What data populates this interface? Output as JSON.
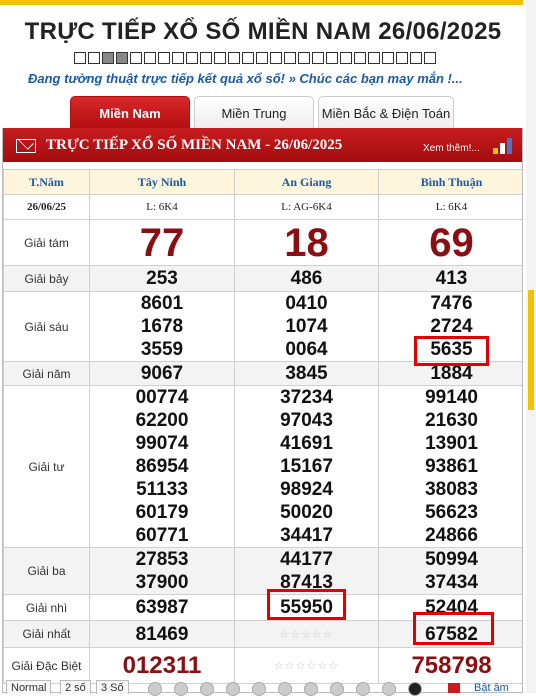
{
  "header": {
    "title": "TRỰC TIẾP XỔ SỐ MIỀN NAM 26/06/2025",
    "marquee": "Đang tường thuật trực tiếp kết quả xổ số! » Chúc các bạn may mắn !..."
  },
  "tabs": [
    {
      "label": "Miền Nam",
      "active": true
    },
    {
      "label": "Miền Trung",
      "active": false
    },
    {
      "label": "Miền Bắc & Điện Toán",
      "active": false
    }
  ],
  "panel": {
    "title": "TRỰC TIẾP XỔ SỐ MIỀN NAM - 26/06/2025",
    "more_link": "Xem thêm!..."
  },
  "table": {
    "col_header": "T.Năm",
    "provinces": [
      "Tây Ninh",
      "An Giang",
      "Bình Thuận"
    ],
    "date": "26/06/25",
    "codes": [
      "L: 6K4",
      "L: AG-6K4",
      "L: 6K4"
    ],
    "prizes": [
      {
        "label": "Giải tám",
        "values": [
          [
            "77"
          ],
          [
            "18"
          ],
          [
            "69"
          ]
        ]
      },
      {
        "label": "Giải bảy",
        "values": [
          [
            "253"
          ],
          [
            "486"
          ],
          [
            "413"
          ]
        ]
      },
      {
        "label": "Giải sáu",
        "values": [
          [
            "8601",
            "1678",
            "3559"
          ],
          [
            "0410",
            "1074",
            "0064"
          ],
          [
            "7476",
            "2724",
            "5635"
          ]
        ]
      },
      {
        "label": "Giải năm",
        "values": [
          [
            "9067"
          ],
          [
            "3845"
          ],
          [
            "1884"
          ]
        ]
      },
      {
        "label": "Giải tư",
        "values": [
          [
            "00774",
            "62200",
            "99074",
            "86954",
            "51133",
            "60179",
            "60771"
          ],
          [
            "37234",
            "97043",
            "41691",
            "15167",
            "98924",
            "50020",
            "34417"
          ],
          [
            "99140",
            "21630",
            "13901",
            "93861",
            "38083",
            "56623",
            "24866"
          ]
        ]
      },
      {
        "label": "Giải ba",
        "values": [
          [
            "27853",
            "37900"
          ],
          [
            "44177",
            "87413"
          ],
          [
            "50994",
            "37434"
          ]
        ]
      },
      {
        "label": "Giải nhì",
        "values": [
          [
            "63987"
          ],
          [
            "55950"
          ],
          [
            "52404"
          ]
        ]
      },
      {
        "label": "Giải nhất",
        "values": [
          [
            "81469"
          ],
          [
            "☆☆☆☆☆"
          ],
          [
            "67582"
          ]
        ]
      },
      {
        "label": "Giải Đặc Biệt",
        "values": [
          [
            "012311"
          ],
          [
            "☆☆☆☆☆☆"
          ],
          [
            "758798"
          ]
        ]
      }
    ]
  },
  "bottom_bar": {
    "buttons": [
      "Normal",
      "2 số",
      "3 Số"
    ],
    "balls": [
      "0",
      "1",
      "2",
      "3",
      "4",
      "5",
      "6",
      "7",
      "8",
      "9"
    ],
    "sound_label": "Bật âm"
  },
  "colors": {
    "accent_red": "#c81d1f",
    "prize_red": "#8b0e12",
    "link_blue": "#1a5aa6",
    "highlight_box": "#e30000"
  }
}
